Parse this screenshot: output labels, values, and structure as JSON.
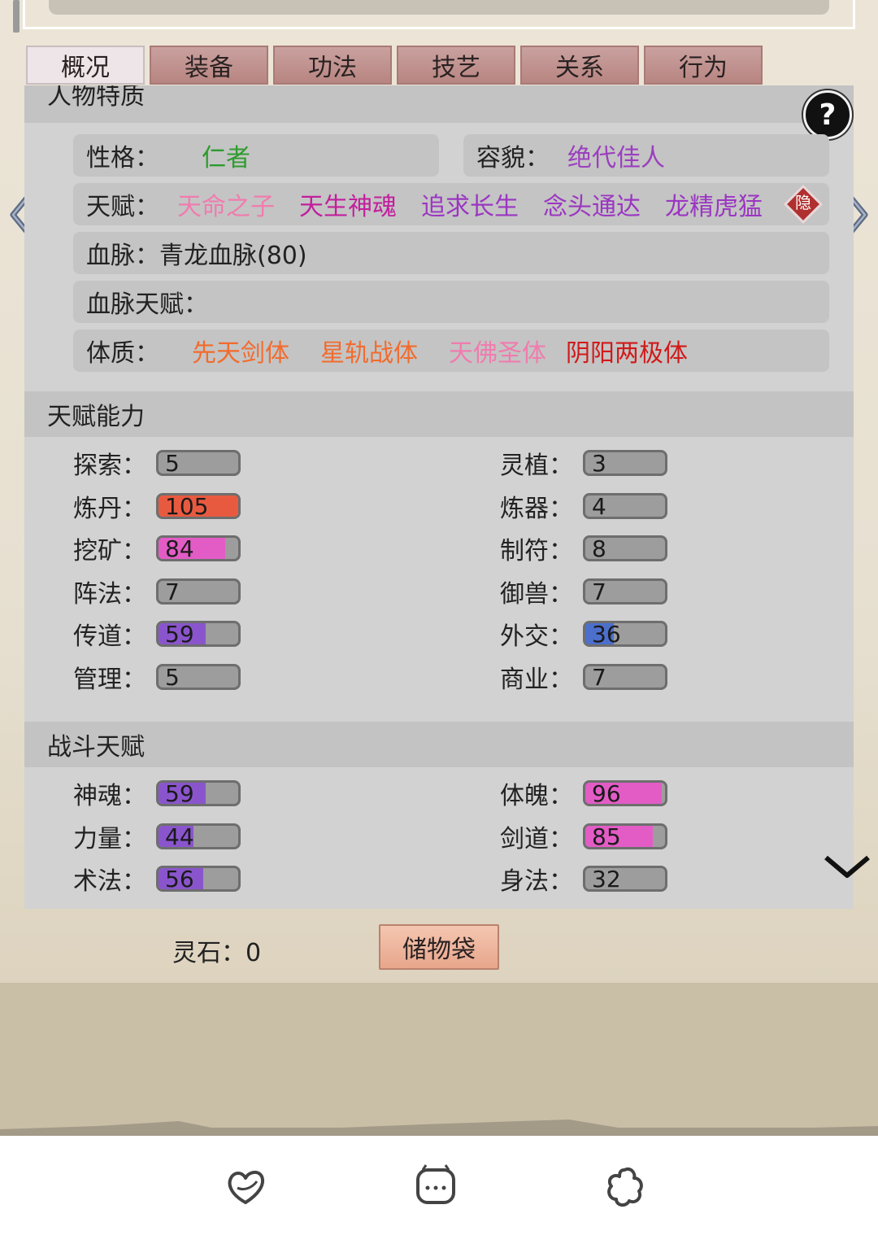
{
  "tabs": [
    {
      "label": "概况",
      "active": true
    },
    {
      "label": "装备"
    },
    {
      "label": "功法"
    },
    {
      "label": "技艺"
    },
    {
      "label": "关系"
    },
    {
      "label": "行为"
    }
  ],
  "traits_section": {
    "title": "人物特质",
    "help_label": "?",
    "personality": {
      "label": "性格：",
      "value": "仁者",
      "color": "#2e9b2e"
    },
    "appearance": {
      "label": "容貌：",
      "value": "绝代佳人",
      "color": "#9b3fbf"
    },
    "talent": {
      "label": "天赋：",
      "values": [
        {
          "text": "天命之子",
          "color": "#f07cae"
        },
        {
          "text": "天生神魂",
          "color": "#c21f9d"
        },
        {
          "text": "追求长生",
          "color": "#9b36c2"
        },
        {
          "text": "念头通达",
          "color": "#9b36c2"
        },
        {
          "text": "龙精虎猛",
          "color": "#9b36c2"
        }
      ],
      "hide_badge": "隐"
    },
    "bloodline": {
      "label": "血脉：",
      "value": "青龙血脉(80)"
    },
    "bloodline_talent": {
      "label": "血脉天赋："
    },
    "physique": {
      "label": "体质：",
      "values": [
        {
          "text": "先天剑体",
          "color": "#f26b2d"
        },
        {
          "text": "星轨战体",
          "color": "#f26b2d"
        },
        {
          "text": "天佛圣体",
          "color": "#f07cae"
        },
        {
          "text": "阴阳两极体",
          "color": "#d11a1a"
        }
      ]
    }
  },
  "ability_section": {
    "title": "天赋能力",
    "left": [
      {
        "label": "探索：",
        "value": "5",
        "fraction": 0.0,
        "color": "#9d9d9d"
      },
      {
        "label": "炼丹：",
        "value": "105",
        "fraction": 1.0,
        "color": "#e85a40"
      },
      {
        "label": "挖矿：",
        "value": "84",
        "fraction": 0.84,
        "color": "#e35cc6"
      },
      {
        "label": "阵法：",
        "value": "7",
        "fraction": 0.0,
        "color": "#9d9d9d"
      },
      {
        "label": "传道：",
        "value": "59",
        "fraction": 0.59,
        "color": "#8a55cc"
      },
      {
        "label": "管理：",
        "value": "5",
        "fraction": 0.0,
        "color": "#9d9d9d"
      }
    ],
    "right": [
      {
        "label": "灵植：",
        "value": "3",
        "fraction": 0.0,
        "color": "#9d9d9d"
      },
      {
        "label": "炼器：",
        "value": "4",
        "fraction": 0.0,
        "color": "#9d9d9d"
      },
      {
        "label": "制符：",
        "value": "8",
        "fraction": 0.0,
        "color": "#9d9d9d"
      },
      {
        "label": "御兽：",
        "value": "7",
        "fraction": 0.0,
        "color": "#9d9d9d"
      },
      {
        "label": "外交：",
        "value": "36",
        "fraction": 0.36,
        "color": "#4c6fcc"
      },
      {
        "label": "商业：",
        "value": "7",
        "fraction": 0.0,
        "color": "#9d9d9d"
      }
    ]
  },
  "combat_section": {
    "title": "战斗天赋",
    "left": [
      {
        "label": "神魂：",
        "value": "59",
        "fraction": 0.59,
        "color": "#8a55cc"
      },
      {
        "label": "力量：",
        "value": "44",
        "fraction": 0.44,
        "color": "#8a55cc"
      },
      {
        "label": "术法：",
        "value": "56",
        "fraction": 0.56,
        "color": "#8a55cc"
      }
    ],
    "right": [
      {
        "label": "体魄：",
        "value": "96",
        "fraction": 0.96,
        "color": "#e35cc6"
      },
      {
        "label": "剑道：",
        "value": "85",
        "fraction": 0.85,
        "color": "#e35cc6"
      },
      {
        "label": "身法：",
        "value": "32",
        "fraction": 0.0,
        "color": "#9d9d9d"
      }
    ]
  },
  "footer": {
    "spirit_stone": "灵石：0",
    "storage_bag": "储物袋"
  },
  "icons": {
    "prev": "chevron-left-icon",
    "next": "chevron-right-icon",
    "expand": "chevron-down-icon",
    "nav": [
      "heart-icon",
      "chat-icon",
      "flower-icon"
    ]
  }
}
